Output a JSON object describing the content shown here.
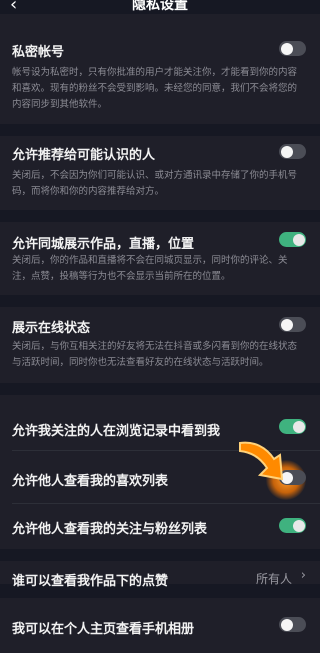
{
  "header": {
    "back_icon": "chevron-left-icon",
    "title": "隐私设置"
  },
  "settings": [
    {
      "label": "私密帐号",
      "desc": "帐号设为私密时，只有你批准的用户才能关注你，才能看到你的内容和喜欢。现有的粉丝不会受到影响。未经您的同意，我们不会将您的内容同步到其他软件。",
      "toggle": false
    },
    {
      "label": "允许推荐给可能认识的人",
      "desc": "关闭后，不会因为你们可能认识、或对方通讯录中存储了你的手机号码，而将你和你的内容推荐给对方。",
      "toggle": false
    },
    {
      "label": "允许同城展示作品，直播，位置",
      "desc": "关闭后，你的作品和直播将不会在同城页显示，同时你的评论、关注，点赞，投稿等行为也不会显示当前所在的位置。",
      "toggle": true
    },
    {
      "label": "展示在线状态",
      "desc": "关闭后，与你互相关注的好友将无法在抖音或多闪看到你的在线状态与活跃时间，同时你也无法查看好友的在线状态与活跃时间。",
      "toggle": false
    },
    {
      "label": "允许我关注的人在浏览记录中看到我",
      "toggle": true
    },
    {
      "label": "允许他人查看我的喜欢列表",
      "toggle": false
    },
    {
      "label": "允许他人查看我的关注与粉丝列表",
      "toggle": true
    },
    {
      "label": "谁可以查看我作品下的点赞",
      "value": "所有人",
      "chevron": "›"
    },
    {
      "label": "我可以在个人主页查看手机相册",
      "toggle": false
    }
  ],
  "colors": {
    "bg": "#161823",
    "card": "#1f1f29",
    "toggle_on": "#3fb27f",
    "toggle_off": "#4b4d56",
    "highlight": "#ff8a00"
  }
}
